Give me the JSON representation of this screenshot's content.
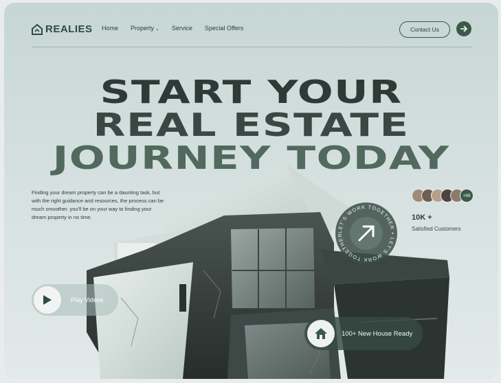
{
  "brand": {
    "name": "REALIES",
    "icon": "house-logo-icon"
  },
  "nav": {
    "items": [
      {
        "label": "Home"
      },
      {
        "label": "Property"
      },
      {
        "label": "Service"
      },
      {
        "label": "Special Offers"
      }
    ],
    "contact_label": "Contact Us"
  },
  "hero": {
    "line1": "START YOUR",
    "line2": "REAL ESTATE",
    "line3": "JOURNEY TODAY",
    "description": "Finding your dream property can be a daunting task, but with the right guidance and resources, the process can be much smoother. you'll be on your way to finding your dream property in no time."
  },
  "social": {
    "more_count": "+99",
    "stat_value": "10K +",
    "stat_label": "Satisfied Customers"
  },
  "badge": {
    "ring_text": "LET'S WORK TOGETHER • LET'S WORK TOGETHER •"
  },
  "play": {
    "label": "Play Videos"
  },
  "house_pill": {
    "label": "100+ New House Ready"
  },
  "colors": {
    "accent": "#3a5a48",
    "dark": "#2f3a36",
    "bg": "#c6d6d5"
  }
}
